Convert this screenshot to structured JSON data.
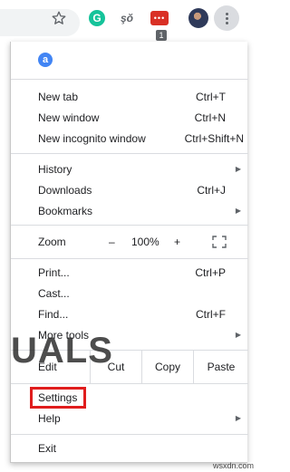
{
  "toolbar": {
    "icons": [
      "star-icon",
      "grammarly-icon",
      "extension-so-icon",
      "extension-red-icon",
      "avatar",
      "more-menu-icon"
    ],
    "grammarly_letter": "G",
    "ext_so_text": "şŏ",
    "ext_red_text": "•••",
    "ext_badge": "1"
  },
  "menu": {
    "account_icon_letter": "a",
    "group1": [
      {
        "label": "New tab",
        "shortcut": "Ctrl+T"
      },
      {
        "label": "New window",
        "shortcut": "Ctrl+N"
      },
      {
        "label": "New incognito window",
        "shortcut": "Ctrl+Shift+N"
      }
    ],
    "group2": [
      {
        "label": "History",
        "shortcut": ""
      },
      {
        "label": "Downloads",
        "shortcut": "Ctrl+J"
      },
      {
        "label": "Bookmarks",
        "shortcut": ""
      }
    ],
    "zoom": {
      "label": "Zoom",
      "minus": "–",
      "value": "100%",
      "plus": "+"
    },
    "group3": [
      {
        "label": "Print...",
        "shortcut": "Ctrl+P"
      },
      {
        "label": "Cast...",
        "shortcut": ""
      },
      {
        "label": "Find...",
        "shortcut": "Ctrl+F"
      },
      {
        "label": "More tools",
        "shortcut": ""
      }
    ],
    "edit": {
      "label": "Edit",
      "cut": "Cut",
      "copy": "Copy",
      "paste": "Paste"
    },
    "group4": [
      {
        "label": "Settings",
        "shortcut": ""
      },
      {
        "label": "Help",
        "shortcut": ""
      }
    ],
    "exit": {
      "label": "Exit"
    }
  },
  "watermark": "UALS",
  "site_watermark": "wsxdn.com",
  "colors": {
    "highlight": "#e01d1d",
    "menu_button_bg": "#dadce0",
    "grammarly": "#15c39a",
    "account": "#4285f4"
  }
}
